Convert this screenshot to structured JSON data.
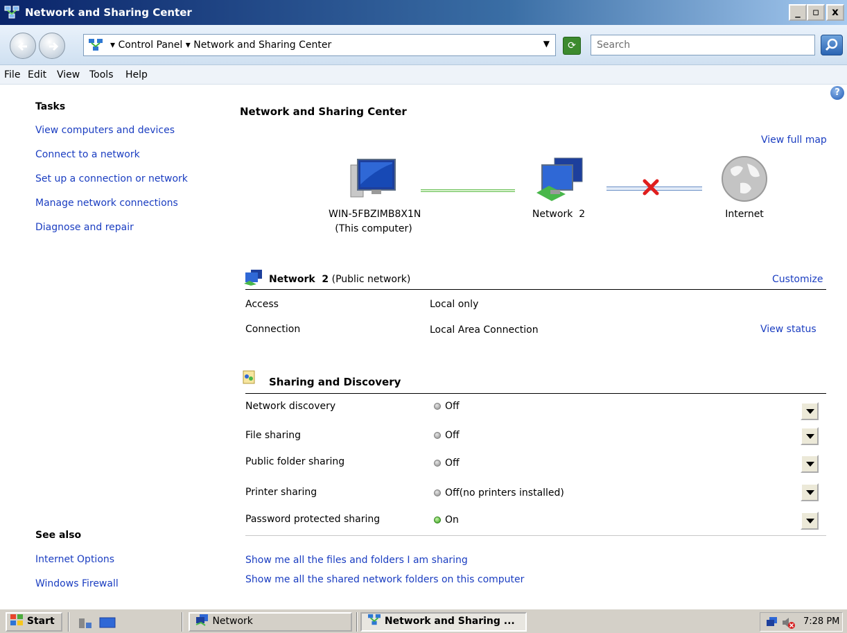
{
  "window": {
    "title": "Network and Sharing Center"
  },
  "window_controls": {
    "minimize": "_",
    "maximize": "▫",
    "close": "x"
  },
  "address": {
    "root_label": "Control Panel",
    "current_label": "Network and Sharing Center",
    "search_placeholder": "Search"
  },
  "menu": [
    "File",
    "Edit",
    "View",
    "Tools",
    "Help"
  ],
  "tasks": {
    "title": "Tasks",
    "items": [
      "View computers and devices",
      "Connect to a network",
      "Set up a connection or network",
      "Manage network connections",
      "Diagnose and repair"
    ]
  },
  "see_also": {
    "title": "See also",
    "items": [
      "Internet Options",
      "Windows Firewall"
    ]
  },
  "main": {
    "heading": "Network and Sharing Center",
    "view_full_map": "View full map",
    "map": {
      "computer_name": "WIN-5FBZIMB8X1N",
      "computer_sub": "(This computer)",
      "network_label": "Network  2",
      "internet_label": "Internet"
    },
    "network": {
      "name": "Network  2",
      "type": "(Public network)",
      "customize": "Customize",
      "rows": [
        {
          "label": "Access",
          "value": "Local only",
          "action": ""
        },
        {
          "label": "Connection",
          "value": "Local Area Connection",
          "action": "View status"
        }
      ]
    },
    "sharing": {
      "title": "Sharing and Discovery",
      "rows": [
        {
          "label": "Network discovery",
          "status": "Off",
          "note": "",
          "on": false
        },
        {
          "label": "File sharing",
          "status": "Off",
          "note": "",
          "on": false
        },
        {
          "label": "Public folder sharing",
          "status": "Off",
          "note": "",
          "on": false
        },
        {
          "label": "Printer sharing",
          "status": "Off",
          "note": "(no printers installed)",
          "on": false
        },
        {
          "label": "Password protected sharing",
          "status": "On",
          "note": "",
          "on": true
        }
      ]
    },
    "links": [
      "Show me all the files and folders I am sharing",
      "Show me all the shared network folders on this computer"
    ]
  },
  "taskbar": {
    "start": "Start",
    "buttons": [
      {
        "label": "Network",
        "active": false
      },
      {
        "label": "Network and Sharing ...",
        "active": true
      }
    ],
    "clock": "7:28 PM"
  },
  "colors": {
    "link": "#1a3dc1",
    "titlebar": "#0a246a",
    "status_on": "#2f9d17",
    "status_off": "#8c8c8c"
  }
}
